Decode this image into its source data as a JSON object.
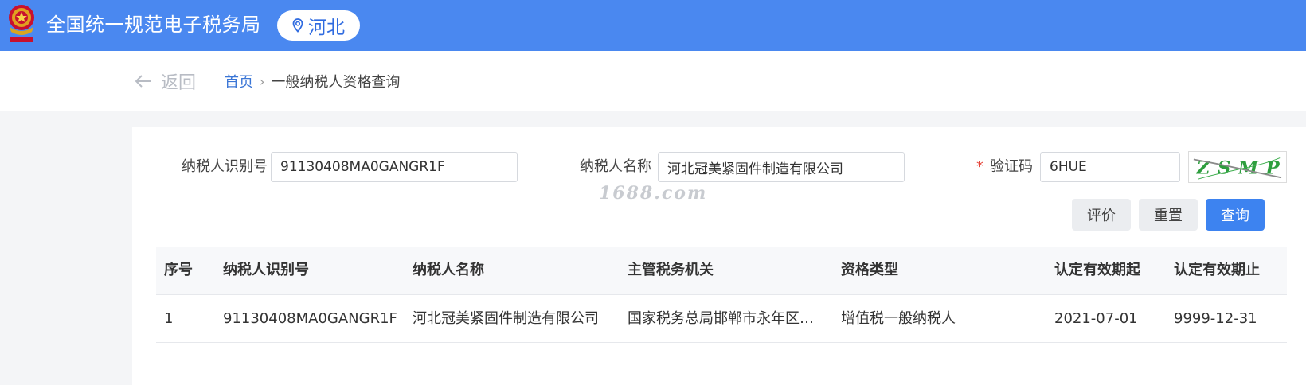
{
  "header": {
    "site_title": "全国统一规范电子税务局",
    "region": "河北",
    "brand_color": "#4a88f0"
  },
  "nav": {
    "back_label": "返回",
    "breadcrumb_home": "首页",
    "breadcrumb_sep": "›",
    "breadcrumb_current": "一般纳税人资格查询"
  },
  "form": {
    "taxpayer_id_label": "纳税人识别号",
    "taxpayer_id_value": "91130408MA0GANGR1F",
    "taxpayer_name_label": "纳税人名称",
    "taxpayer_name_value": "河北冠美紧固件制造有限公司",
    "captcha_required_mark": "*",
    "captcha_label": "验证码",
    "captcha_value": "6HUE",
    "captcha_image_text": "ZSMP"
  },
  "watermark": "1688.com",
  "buttons": {
    "evaluate": "评价",
    "reset": "重置",
    "query": "查询"
  },
  "table": {
    "columns": [
      "序号",
      "纳税人识别号",
      "纳税人名称",
      "主管税务机关",
      "资格类型",
      "认定有效期起",
      "认定有效期止"
    ],
    "rows": [
      [
        "1",
        "91130408MA0GANGR1F",
        "河北冠美紧固件制造有限公司",
        "国家税务总局邯郸市永年区税…",
        "增值税一般纳税人",
        "2021-07-01",
        "9999-12-31"
      ]
    ]
  }
}
